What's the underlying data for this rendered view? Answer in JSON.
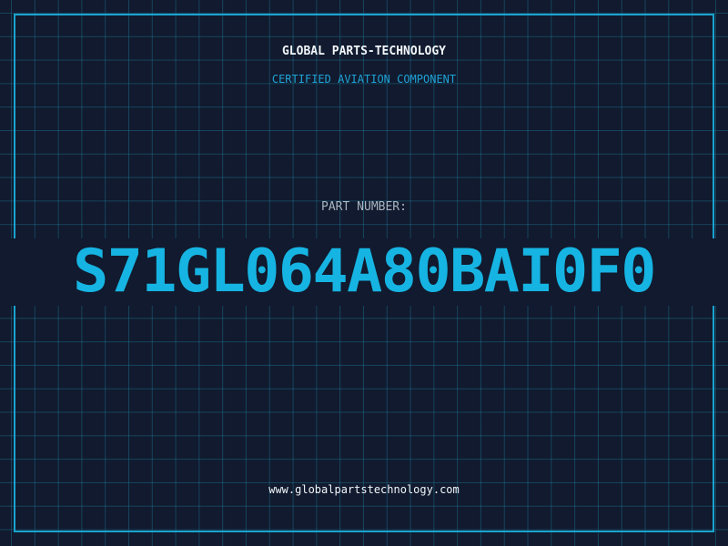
{
  "header": {
    "company": "GLOBAL PARTS-TECHNOLOGY",
    "subtitle": "CERTIFIED AVIATION COMPONENT"
  },
  "part": {
    "label": "PART NUMBER:",
    "number": "S71GL064A80BAI0F0"
  },
  "footer": {
    "url": "www.globalpartstechnology.com"
  },
  "colors": {
    "background": "#111a2e",
    "grid": "#1c7896",
    "accent": "#16b4e2",
    "text": "#f2f6fa",
    "muted": "#a9b4c0"
  }
}
